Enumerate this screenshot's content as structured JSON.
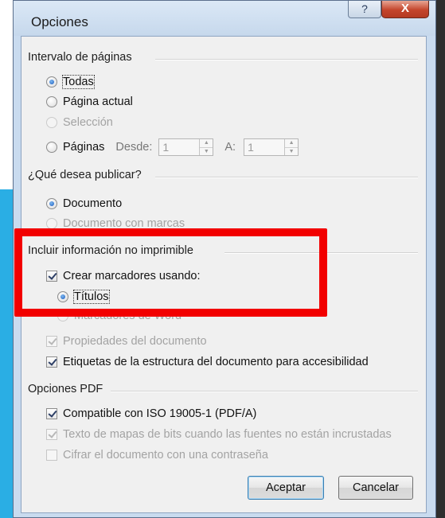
{
  "dialog": {
    "title": "Opciones",
    "help_label": "?",
    "close_label": "X"
  },
  "page_range": {
    "heading": "Intervalo de páginas",
    "options": [
      {
        "label": "Todas",
        "selected": true,
        "enabled": true
      },
      {
        "label": "Página actual",
        "selected": false,
        "enabled": true
      },
      {
        "label": "Selección",
        "selected": false,
        "enabled": false
      },
      {
        "label": "Páginas",
        "selected": false,
        "enabled": true
      }
    ],
    "from_label": "Desde:",
    "from_value": "1",
    "to_label": "A:",
    "to_value": "1"
  },
  "publish": {
    "heading": "¿Qué desea publicar?",
    "options": [
      {
        "label": "Documento",
        "selected": true,
        "enabled": true
      },
      {
        "label": "Documento con marcas",
        "selected": false,
        "enabled": false
      }
    ]
  },
  "non_printable": {
    "heading": "Incluir información no imprimible",
    "create_bookmarks": {
      "label": "Crear marcadores usando:",
      "checked": true
    },
    "bookmark_options": [
      {
        "label": "Títulos",
        "selected": true,
        "enabled": true
      },
      {
        "label": "Marcadores de Word",
        "selected": false,
        "enabled": false
      }
    ],
    "doc_properties": {
      "label": "Propiedades del documento",
      "checked": true,
      "enabled": false
    },
    "structure_tags": {
      "label": "Etiquetas de la estructura del documento para accesibilidad",
      "checked": true,
      "enabled": true
    }
  },
  "pdf_options": {
    "heading": "Opciones PDF",
    "iso": {
      "label": "Compatible con ISO 19005-1 (PDF/A)",
      "checked": true,
      "enabled": true
    },
    "bitmap_text": {
      "label": "Texto de mapas de bits cuando las fuentes no están incrustadas",
      "checked": true,
      "enabled": false
    },
    "encrypt": {
      "label": "Cifrar el documento con una contraseña",
      "checked": false,
      "enabled": false
    }
  },
  "buttons": {
    "accept": "Aceptar",
    "cancel": "Cancelar"
  },
  "colors": {
    "highlight": "#f20000",
    "side_panel": "#2aaee4"
  }
}
